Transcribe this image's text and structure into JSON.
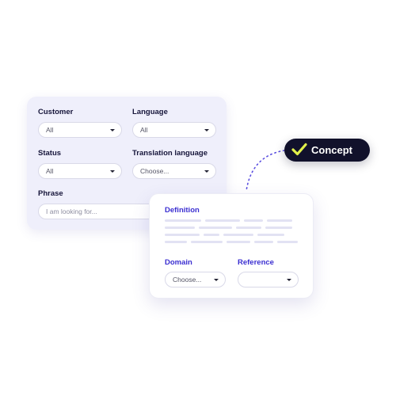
{
  "filters": {
    "customer": {
      "label": "Customer",
      "value": "All"
    },
    "language": {
      "label": "Language",
      "value": "All"
    },
    "status": {
      "label": "Status",
      "value": "All"
    },
    "translation_language": {
      "label": "Translation language",
      "value": "Choose..."
    },
    "phrase": {
      "label": "Phrase",
      "placeholder": "I am looking for..."
    }
  },
  "concept_badge": {
    "label": "Concept",
    "icon": "check-icon",
    "check_color": "#e1f04a"
  },
  "concept_card": {
    "definition_label": "Definition",
    "domain": {
      "label": "Domain",
      "value": "Choose..."
    },
    "reference": {
      "label": "Reference",
      "value": ""
    }
  },
  "colors": {
    "accent": "#3b2fd1",
    "dark": "#11112b",
    "panel": "#efeffb"
  }
}
